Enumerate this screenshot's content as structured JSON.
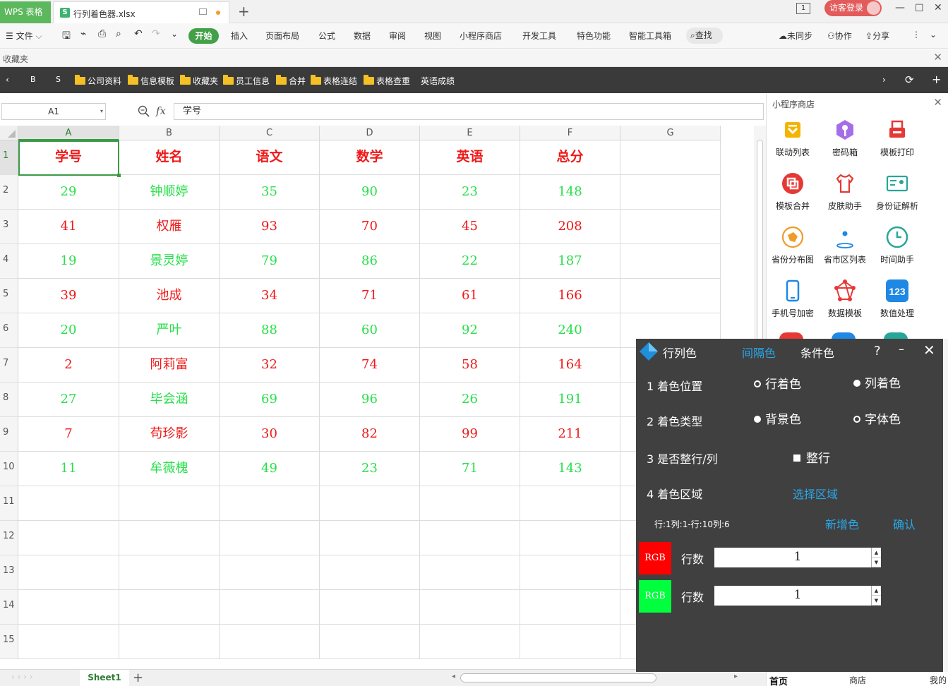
{
  "titlebar": {
    "app_tab": "WPS 表格",
    "doc_tab": "行列着色器.xlsx",
    "doc_badge": "S",
    "login": "访客登录",
    "page_indicator": "1"
  },
  "ribbon": {
    "file": "文件",
    "items": [
      "开始",
      "插入",
      "页面布局",
      "公式",
      "数据",
      "审阅",
      "视图",
      "小程序商店",
      "开发工具",
      "特色功能",
      "智能工具箱"
    ],
    "find": "查找",
    "sync": "未同步",
    "collab": "协作",
    "share": "分享"
  },
  "favorites": {
    "label": "收藏夹"
  },
  "bookmarks": {
    "items": [
      "B",
      "S",
      "公司资料",
      "信息模板",
      "收藏夹",
      "员工信息",
      "合并",
      "表格连结",
      "表格查重",
      "英语成绩"
    ]
  },
  "formula": {
    "cell_ref": "A1",
    "fx": "fx",
    "content": "学号"
  },
  "sheet": {
    "columns": [
      "A",
      "B",
      "C",
      "D",
      "E",
      "F",
      "G"
    ],
    "row_numbers": [
      "1",
      "2",
      "3",
      "4",
      "5",
      "6",
      "7",
      "8",
      "9",
      "10",
      "11",
      "12",
      "13",
      "14",
      "15"
    ],
    "header": [
      "学号",
      "姓名",
      "语文",
      "数学",
      "英语",
      "总分"
    ],
    "rows": [
      [
        "29",
        "钟顺婷",
        "35",
        "90",
        "23",
        "148"
      ],
      [
        "41",
        "权雁",
        "93",
        "70",
        "45",
        "208"
      ],
      [
        "19",
        "景灵婷",
        "79",
        "86",
        "22",
        "187"
      ],
      [
        "39",
        "池成",
        "34",
        "71",
        "61",
        "166"
      ],
      [
        "20",
        "严叶",
        "88",
        "60",
        "92",
        "240"
      ],
      [
        "2",
        "阿莉富",
        "32",
        "74",
        "58",
        "164"
      ],
      [
        "27",
        "毕会涵",
        "69",
        "96",
        "26",
        "191"
      ],
      [
        "7",
        "苟珍影",
        "30",
        "82",
        "99",
        "211"
      ],
      [
        "11",
        "牟薇槐",
        "49",
        "23",
        "71",
        "143"
      ]
    ],
    "row_colors": [
      "#28e04b",
      "#f01818",
      "#28e04b",
      "#f01818",
      "#28e04b",
      "#f01818",
      "#28e04b",
      "#f01818",
      "#28e04b"
    ],
    "tab": "Sheet1"
  },
  "pane": {
    "title": "小程序商店",
    "apps": [
      {
        "label": "联动列表",
        "icon": "list-icon",
        "color": "#f4b400"
      },
      {
        "label": "密码箱",
        "icon": "key-icon",
        "color": "#a56ee8"
      },
      {
        "label": "模板打印",
        "icon": "printer-icon",
        "color": "#e53935"
      },
      {
        "label": "模板合并",
        "icon": "merge-icon",
        "color": "#e53935"
      },
      {
        "label": "皮肤助手",
        "icon": "shirt-icon",
        "color": "#e53935"
      },
      {
        "label": "身份证解析",
        "icon": "idcard-icon",
        "color": "#26a69a"
      },
      {
        "label": "省份分布图",
        "icon": "map-icon",
        "color": "#f09a28"
      },
      {
        "label": "省市区列表",
        "icon": "location-icon",
        "color": "#1e88e5"
      },
      {
        "label": "时间助手",
        "icon": "clock-icon",
        "color": "#26a69a"
      },
      {
        "label": "手机号加密",
        "icon": "phone-icon",
        "color": "#1e88e5"
      },
      {
        "label": "数据模板",
        "icon": "network-icon",
        "color": "#e53935"
      },
      {
        "label": "数值处理",
        "icon": "number-icon",
        "color": "#1e88e5"
      }
    ],
    "bottom": [
      "首页",
      "商店",
      "我的"
    ]
  },
  "dialog": {
    "tabs": [
      "行列色",
      "间隔色",
      "条件色"
    ],
    "help": "?",
    "opt1_label": "1 着色位置",
    "opt1_a": "行着色",
    "opt1_b": "列着色",
    "opt2_label": "2 着色类型",
    "opt2_a": "背景色",
    "opt2_b": "字体色",
    "opt3_label": "3 是否整行/列",
    "opt3_a": "整行",
    "opt4_label": "4 着色区域",
    "select_area": "选择区域",
    "range_info": "行:1列:1-行:10列:6",
    "add_color": "新增色",
    "confirm": "确认",
    "colors": [
      {
        "rgb_label": "RGB",
        "color": "#ff0000",
        "count_label": "行数",
        "value": "1"
      },
      {
        "rgb_label": "RGB",
        "color": "#00ff3c",
        "count_label": "行数",
        "value": "1"
      }
    ]
  }
}
